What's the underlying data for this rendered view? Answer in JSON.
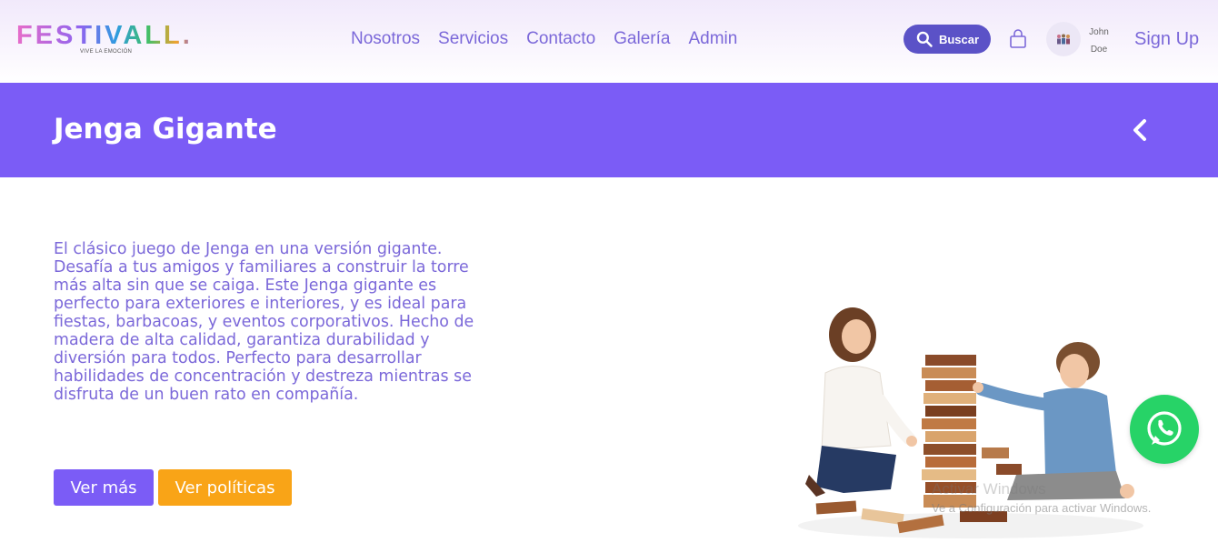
{
  "header": {
    "logo": {
      "word": "FESTIVALL.",
      "tagline": "VIVE LA EMOCIÓN"
    },
    "nav": [
      "Nosotros",
      "Servicios",
      "Contacto",
      "Galería",
      "Admin"
    ],
    "search_label": "Buscar",
    "user": {
      "first": "John",
      "last": "Doe"
    },
    "signup_label": "Sign Up"
  },
  "banner": {
    "title": "Jenga Gigante"
  },
  "product": {
    "description": "El clásico juego de Jenga en una versión gigante. Desafía a tus amigos y familiares a construir la torre más alta sin que se caiga. Este Jenga gigante es perfecto para exteriores e interiores, y es ideal para fiestas, barbacoas, y eventos corporativos. Hecho de madera de alta calidad, garantiza durabilidad y diversión para todos. Perfecto para desarrollar habilidades de concentración y destreza mientras se disfruta de un buen rato en compañía.",
    "more_label": "Ver más",
    "policy_label": "Ver políticas"
  },
  "overlay": {
    "watermark_line1": "Activar Windows",
    "watermark_line2": "Ve a Configuración para activar Windows."
  },
  "colors": {
    "primary": "#7b5cf6",
    "nav_text": "#7b68d9",
    "search_bg": "#5b52c7",
    "accent_orange": "#f9a417",
    "whatsapp": "#27d367"
  },
  "icons": [
    "search-icon",
    "bag-icon",
    "avatar-icon",
    "chevron-left-icon",
    "whatsapp-icon"
  ]
}
